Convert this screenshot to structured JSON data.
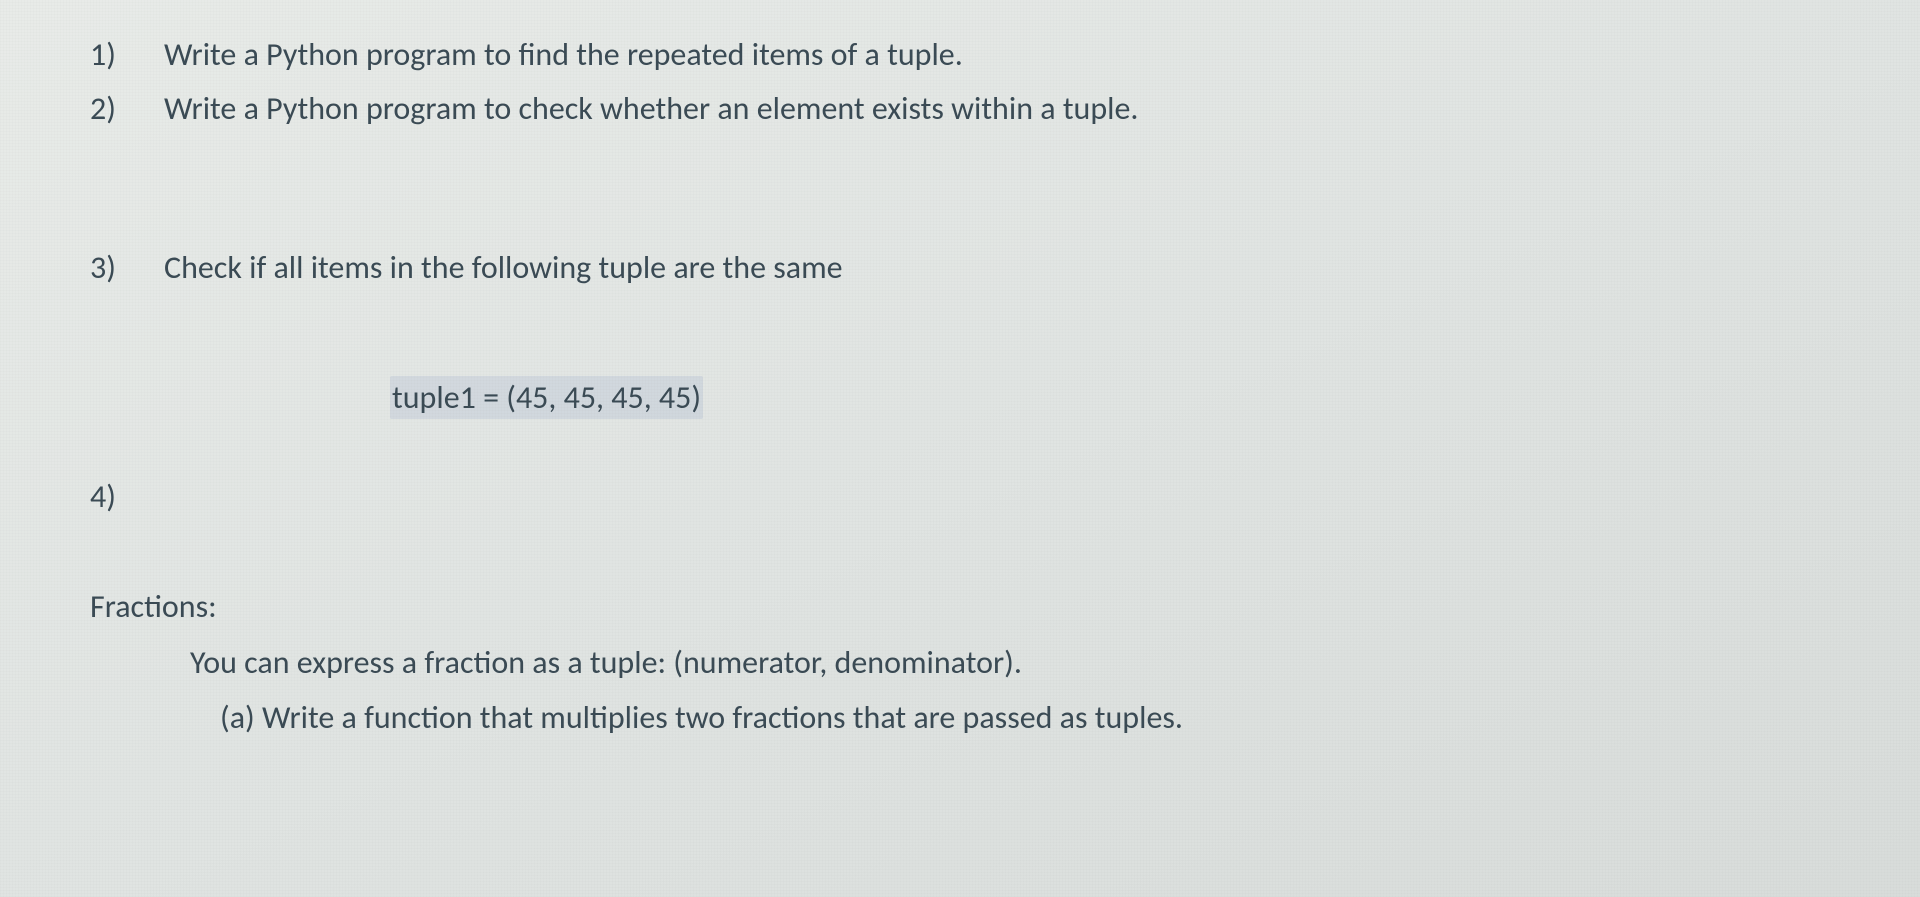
{
  "questions": {
    "q1": {
      "marker": "1)",
      "text": "Write a Python program to find the repeated items of a tuple."
    },
    "q2": {
      "marker": "2)",
      "text": "Write a Python program to check whether an element exists within a tuple."
    },
    "q3": {
      "marker": "3)",
      "text": "Check if all items in the following tuple are the same"
    },
    "code": "tuple1 = (45, 45, 45, 45)",
    "q4_marker": "4)",
    "fractions_label": "Fractions:",
    "fractions_line1": "You can express a fraction as a tuple: (numerator, denominator).",
    "fractions_line2": "(a) Write a function that multiplies two fractions that are passed as tuples."
  }
}
